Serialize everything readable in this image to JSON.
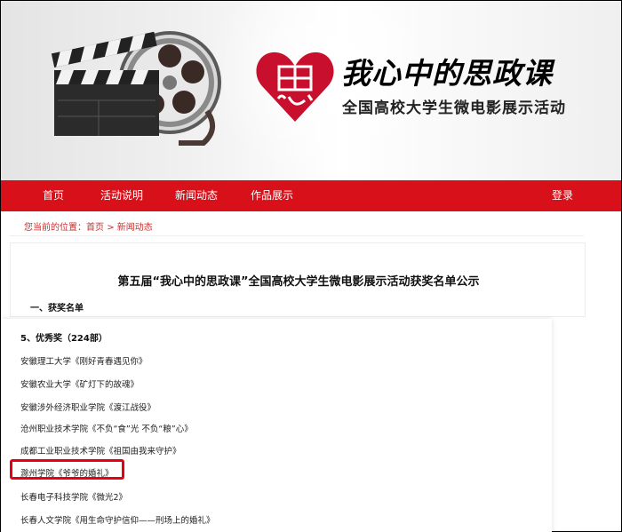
{
  "banner": {
    "title_main": "我心中的思政课",
    "title_sub": "全国高校大学生微电影展示活动",
    "logo_char": "思",
    "colors": {
      "brand_red": "#d7101a",
      "logo_red": "#c8102e"
    }
  },
  "nav": {
    "items": [
      {
        "label": "首页"
      },
      {
        "label": "活动说明"
      },
      {
        "label": "新闻动态"
      },
      {
        "label": "作品展示"
      }
    ],
    "login": "登录"
  },
  "breadcrumb": {
    "prefix": "您当前的位置：",
    "home": "首页",
    "sep1": ">",
    "current": "新闻动态"
  },
  "article": {
    "title": "第五届“我心中的思政课”全国高校大学生微电影展示活动获奖名单公示",
    "section": "一、获奖名单"
  },
  "awards": {
    "heading": "5、优秀奖（224部）",
    "items": [
      "安徽理工大学《刚好青春遇见你》",
      "安徽农业大学《矿灯下的故魂》",
      "安徽涉外经济职业学院《渡江战役》",
      "沧州职业技术学院《不负“食”光 不负“粮”心》",
      "成都工业职业技术学院《祖国由我来守护》",
      "滁州学院《爷爷的婚礼》",
      "长春电子科技学院《微光2》",
      "长春人文学院《用生命守护信仰——刑场上的婚礼》"
    ]
  }
}
